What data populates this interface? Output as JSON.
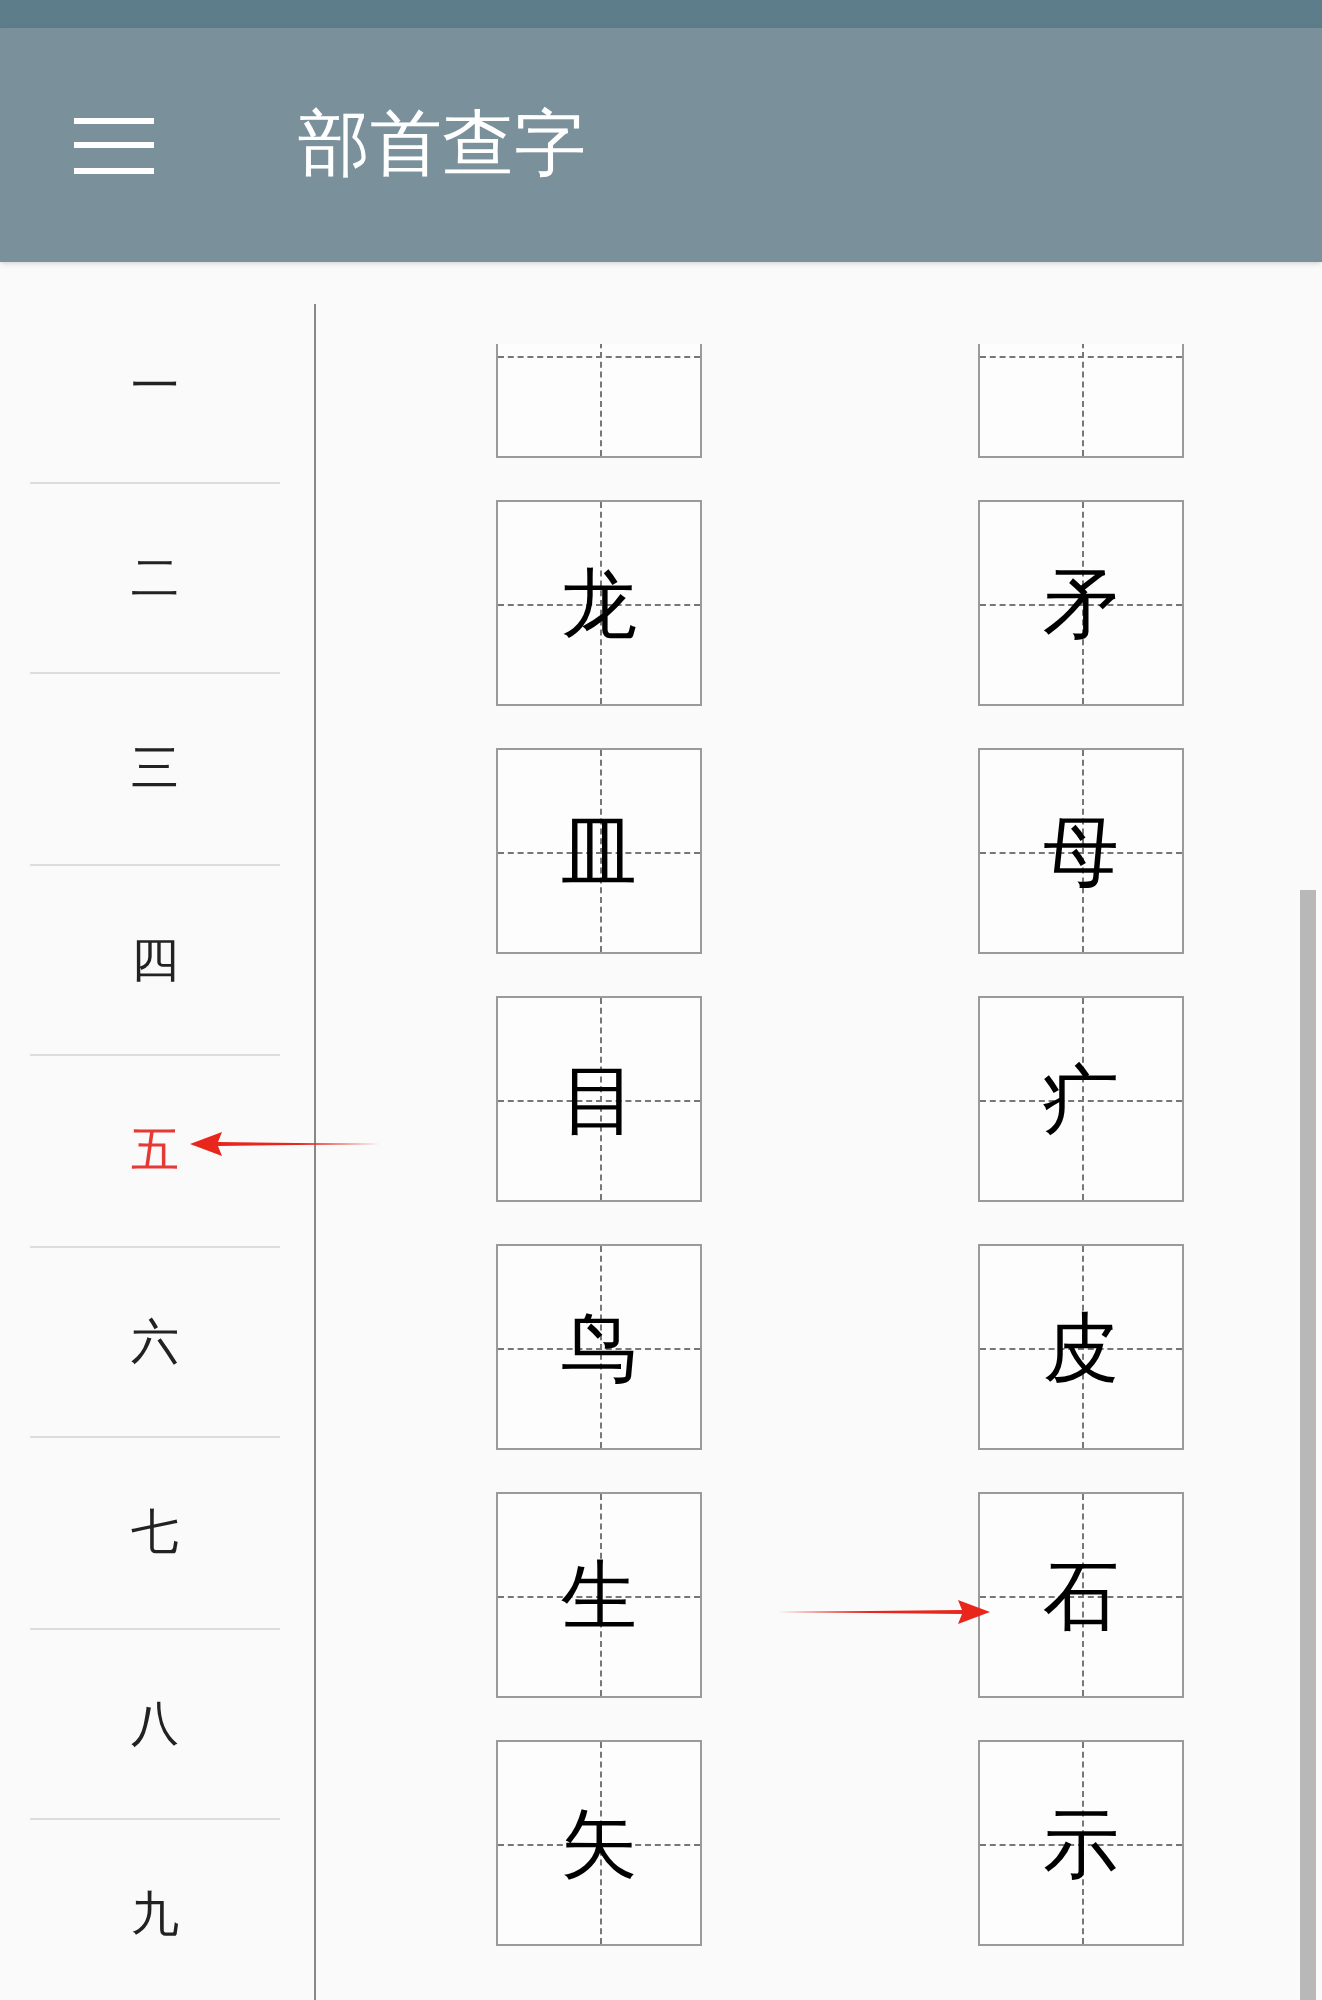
{
  "header": {
    "title": "部首查字"
  },
  "strokes": [
    {
      "label": "一",
      "selected": false
    },
    {
      "label": "二",
      "selected": false
    },
    {
      "label": "三",
      "selected": false
    },
    {
      "label": "四",
      "selected": false
    },
    {
      "label": "五",
      "selected": true
    },
    {
      "label": "六",
      "selected": false
    },
    {
      "label": "七",
      "selected": false
    },
    {
      "label": "八",
      "selected": false
    },
    {
      "label": "九",
      "selected": false
    }
  ],
  "radicals": [
    [
      "龙",
      "矛"
    ],
    [
      "皿",
      "母"
    ],
    [
      "目",
      "疒"
    ],
    [
      "鸟",
      "皮"
    ],
    [
      "生",
      "石"
    ],
    [
      "矢",
      "示"
    ]
  ]
}
